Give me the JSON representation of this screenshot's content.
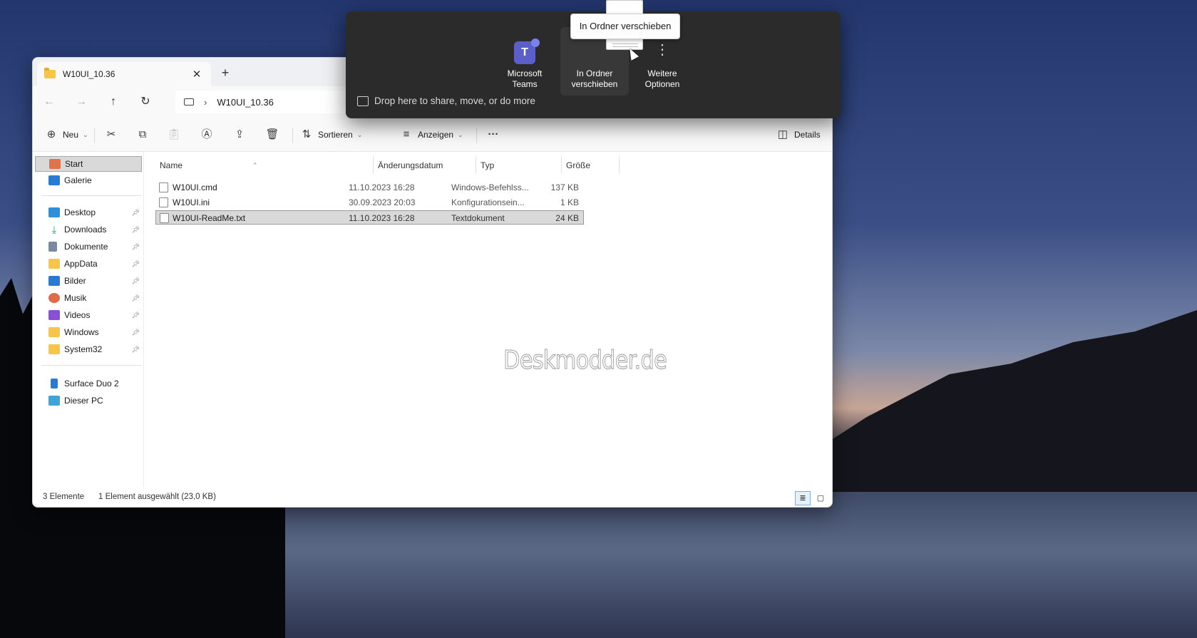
{
  "window": {
    "tab_title": "W10UI_10.36",
    "tab_close": "✕",
    "tab_add": "+",
    "address_path": "W10UI_10.36",
    "address_sep": "›"
  },
  "toolbar": {
    "new_label": "Neu",
    "sort_label": "Sortieren",
    "view_label": "Anzeigen",
    "more_label": "···",
    "details_label": "Details"
  },
  "sidebar": {
    "items": [
      {
        "label": "Start",
        "icon": "home-icon",
        "selected": true
      },
      {
        "label": "Galerie",
        "icon": "gallery-icon"
      },
      {
        "label": "Desktop",
        "icon": "desktop-icon",
        "pinned": true
      },
      {
        "label": "Downloads",
        "icon": "downloads-icon",
        "pinned": true
      },
      {
        "label": "Dokumente",
        "icon": "documents-icon",
        "pinned": true
      },
      {
        "label": "AppData",
        "icon": "folder-icon",
        "pinned": true
      },
      {
        "label": "Bilder",
        "icon": "pictures-icon",
        "pinned": true
      },
      {
        "label": "Musik",
        "icon": "music-icon",
        "pinned": true
      },
      {
        "label": "Videos",
        "icon": "videos-icon",
        "pinned": true
      },
      {
        "label": "Windows",
        "icon": "folder-icon",
        "pinned": true
      },
      {
        "label": "System32",
        "icon": "folder-icon",
        "pinned": true
      },
      {
        "label": "Surface Duo 2",
        "icon": "phone-icon"
      },
      {
        "label": "Dieser PC",
        "icon": "pc-icon"
      }
    ]
  },
  "file_list": {
    "columns": [
      "Name",
      "Änderungsdatum",
      "Typ",
      "Größe"
    ],
    "rows": [
      {
        "name": "W10UI.cmd",
        "date": "11.10.2023 16:28",
        "type": "Windows-Befehlss...",
        "size": "137 KB"
      },
      {
        "name": "W10UI.ini",
        "date": "30.09.2023 20:03",
        "type": "Konfigurationsein...",
        "size": "1 KB"
      },
      {
        "name": "W10UI-ReadMe.txt",
        "date": "11.10.2023 16:28",
        "type": "Textdokument",
        "size": "24 KB",
        "selected": true
      }
    ]
  },
  "watermark": "Deskmodder.de",
  "statusbar": {
    "count": "3 Elemente",
    "selection": "1 Element ausgewählt (23,0 KB)"
  },
  "share": {
    "options": [
      {
        "label_1": "Microsoft",
        "label_2": "Teams",
        "icon": "teams-icon"
      },
      {
        "label_1": "In Ordner",
        "label_2": "verschieben",
        "icon": "folder-icon"
      },
      {
        "label_1": "Weitere",
        "label_2": "Optionen",
        "icon": "more-icon"
      }
    ],
    "hint": "Drop here to share, move, or do more",
    "tooltip": "In Ordner verschieben"
  },
  "colors": {
    "accent": "#5b5fc7",
    "folder": "#f6c54a",
    "selection": "#d9d9d9"
  }
}
